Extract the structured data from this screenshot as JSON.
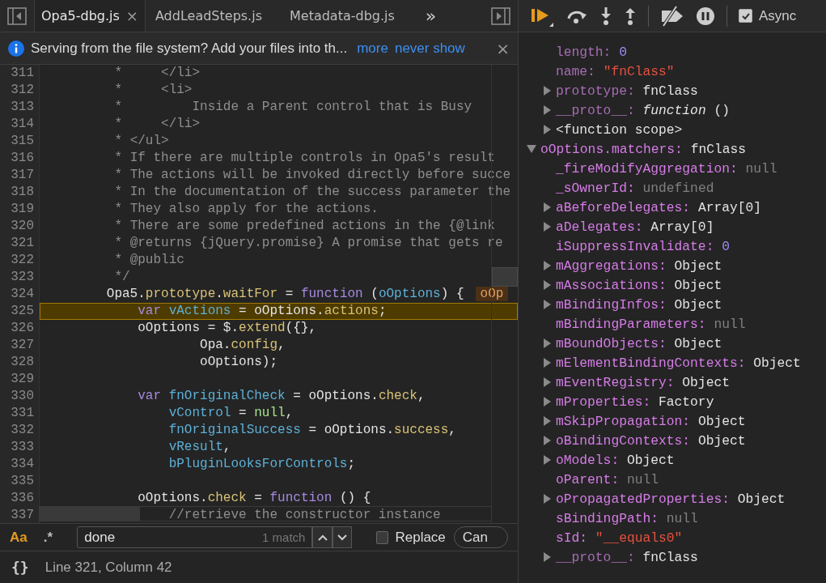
{
  "editor": {
    "tabs": [
      {
        "label": "Opa5-dbg.js",
        "selected": true,
        "close": "×"
      },
      {
        "label": "AddLeadSteps.js",
        "selected": false
      },
      {
        "label": "Metadata-dbg.js",
        "selected": false
      }
    ],
    "overflow": "»",
    "infobar": {
      "message": "Serving from the file system? Add your files into th...",
      "links": [
        "more",
        "never show"
      ],
      "close": "×"
    },
    "lines": [
      {
        "number": "311",
        "current": false,
        "tokens": [
          {
            "kind": "comment",
            "text": "         *     </li>"
          }
        ]
      },
      {
        "number": "312",
        "current": false,
        "tokens": [
          {
            "kind": "comment",
            "text": "         *     <li>"
          }
        ]
      },
      {
        "number": "313",
        "current": false,
        "tokens": [
          {
            "kind": "comment",
            "text": "         *         Inside a Parent control that is Busy"
          }
        ]
      },
      {
        "number": "314",
        "current": false,
        "tokens": [
          {
            "kind": "comment",
            "text": "         *     </li>"
          }
        ]
      },
      {
        "number": "315",
        "current": false,
        "tokens": [
          {
            "kind": "comment",
            "text": "         * </ul>"
          }
        ]
      },
      {
        "number": "316",
        "current": false,
        "tokens": [
          {
            "kind": "comment",
            "text": "         * If there are multiple controls in Opa5's result"
          }
        ]
      },
      {
        "number": "317",
        "current": false,
        "tokens": [
          {
            "kind": "comment",
            "text": "         * The actions will be invoked directly before succe"
          }
        ]
      },
      {
        "number": "318",
        "current": false,
        "tokens": [
          {
            "kind": "comment",
            "text": "         * In the documentation of the success parameter the"
          }
        ]
      },
      {
        "number": "319",
        "current": false,
        "tokens": [
          {
            "kind": "comment",
            "text": "         * They also apply for the actions."
          }
        ]
      },
      {
        "number": "320",
        "current": false,
        "tokens": [
          {
            "kind": "comment",
            "text": "         * There are some predefined actions in the {@link"
          }
        ]
      },
      {
        "number": "321",
        "current": false,
        "tokens": [
          {
            "kind": "comment",
            "text": "         * @returns {jQuery.promise} A promise that gets re"
          }
        ]
      },
      {
        "number": "322",
        "current": false,
        "tokens": [
          {
            "kind": "comment",
            "text": "         * @public"
          }
        ]
      },
      {
        "number": "323",
        "current": false,
        "tokens": [
          {
            "kind": "comment",
            "text": "         */"
          }
        ]
      },
      {
        "number": "324",
        "current": false,
        "inline_value": "oOp",
        "tokens": [
          {
            "kind": "plain",
            "text": "        Opa5."
          },
          {
            "kind": "property",
            "text": "prototype"
          },
          {
            "kind": "plain",
            "text": "."
          },
          {
            "kind": "property",
            "text": "waitFor"
          },
          {
            "kind": "plain",
            "text": " = "
          },
          {
            "kind": "keyword",
            "text": "function"
          },
          {
            "kind": "plain",
            "text": " ("
          },
          {
            "kind": "variable",
            "text": "oOptions"
          },
          {
            "kind": "plain",
            "text": ") {"
          }
        ]
      },
      {
        "number": "325",
        "current": true,
        "tokens": [
          {
            "kind": "keyword",
            "text": "            var"
          },
          {
            "kind": "variable",
            "text": " vActions"
          },
          {
            "kind": "plain",
            "text": " = oOptions."
          },
          {
            "kind": "property",
            "text": "actions"
          },
          {
            "kind": "plain",
            "text": ";"
          }
        ]
      },
      {
        "number": "326",
        "current": false,
        "tokens": [
          {
            "kind": "plain",
            "text": "            oOptions = $."
          },
          {
            "kind": "property",
            "text": "extend"
          },
          {
            "kind": "plain",
            "text": "({},"
          }
        ]
      },
      {
        "number": "327",
        "current": false,
        "tokens": [
          {
            "kind": "plain",
            "text": "                    Opa."
          },
          {
            "kind": "property",
            "text": "config"
          },
          {
            "kind": "plain",
            "text": ","
          }
        ]
      },
      {
        "number": "328",
        "current": false,
        "tokens": [
          {
            "kind": "plain",
            "text": "                    oOptions);"
          }
        ]
      },
      {
        "number": "329",
        "current": false
      },
      {
        "number": "330",
        "current": false,
        "tokens": [
          {
            "kind": "keyword",
            "text": "            var"
          },
          {
            "kind": "variable",
            "text": " fnOriginalCheck"
          },
          {
            "kind": "plain",
            "text": " = oOptions."
          },
          {
            "kind": "property",
            "text": "check"
          },
          {
            "kind": "plain",
            "text": ","
          }
        ]
      },
      {
        "number": "331",
        "current": false,
        "tokens": [
          {
            "kind": "variable",
            "text": "                vControl"
          },
          {
            "kind": "plain",
            "text": " = "
          },
          {
            "kind": "literal",
            "text": "null"
          },
          {
            "kind": "plain",
            "text": ","
          }
        ]
      },
      {
        "number": "332",
        "current": false,
        "tokens": [
          {
            "kind": "variable",
            "text": "                fnOriginalSuccess"
          },
          {
            "kind": "plain",
            "text": " = oOptions."
          },
          {
            "kind": "property",
            "text": "success"
          },
          {
            "kind": "plain",
            "text": ","
          }
        ]
      },
      {
        "number": "333",
        "current": false,
        "tokens": [
          {
            "kind": "variable",
            "text": "                vResult"
          },
          {
            "kind": "plain",
            "text": ","
          }
        ]
      },
      {
        "number": "334",
        "current": false,
        "tokens": [
          {
            "kind": "variable",
            "text": "                bPluginLooksForControls"
          },
          {
            "kind": "plain",
            "text": ";"
          }
        ]
      },
      {
        "number": "335",
        "current": false
      },
      {
        "number": "336",
        "current": false,
        "tokens": [
          {
            "kind": "plain",
            "text": "            oOptions."
          },
          {
            "kind": "property",
            "text": "check"
          },
          {
            "kind": "plain",
            "text": " = "
          },
          {
            "kind": "keyword",
            "text": "function"
          },
          {
            "kind": "plain",
            "text": " () {"
          }
        ]
      },
      {
        "number": "337",
        "current": false,
        "tokens": [
          {
            "kind": "comment",
            "text": "                //retrieve the constructor instance"
          }
        ]
      }
    ],
    "search": {
      "match_case": {
        "label": "Aa",
        "on": true
      },
      "regex": {
        "label": ".*",
        "on": false
      },
      "value": "done",
      "match_count": "1 match",
      "replace": {
        "label": "Replace",
        "checked": false
      },
      "cancel": "Can"
    },
    "status": {
      "format": "{}",
      "position": "Line 321, Column 42"
    }
  },
  "debugger": {
    "async": {
      "label": "Async",
      "checked": true
    },
    "scope_tail": [
      {
        "kind": "number",
        "expandable": false,
        "dim": true,
        "name": "length:",
        "value": "0"
      },
      {
        "kind": "string",
        "expandable": false,
        "dim": true,
        "name": "name:",
        "value": "\"fnClass\""
      },
      {
        "kind": "object",
        "expandable": true,
        "expanded": false,
        "dim": true,
        "name": "prototype:",
        "value": "fnClass"
      },
      {
        "kind": "function",
        "expandable": true,
        "expanded": false,
        "dim": true,
        "name": "__proto__:",
        "value": "*function* ()"
      },
      {
        "kind": "scope",
        "expandable": true,
        "expanded": false,
        "dim": false,
        "name": "<function scope>"
      }
    ],
    "scope": [
      {
        "kind": "object",
        "expandable": true,
        "expanded": true,
        "dim": false,
        "name": "oOptions.matchers:",
        "value": "fnClass",
        "children": [
          {
            "kind": "null",
            "expandable": false,
            "dim": false,
            "name": "_fireModifyAggregation:",
            "value": "null"
          },
          {
            "kind": "null",
            "expandable": false,
            "dim": false,
            "name": "_sOwnerId:",
            "value": "undefined"
          },
          {
            "kind": "object",
            "expandable": true,
            "expanded": false,
            "dim": false,
            "name": "aBeforeDelegates:",
            "value": "Array[0]"
          },
          {
            "kind": "object",
            "expandable": true,
            "expanded": false,
            "dim": false,
            "name": "aDelegates:",
            "value": "Array[0]"
          },
          {
            "kind": "number",
            "expandable": false,
            "dim": false,
            "name": "iSuppressInvalidate:",
            "value": "0"
          },
          {
            "kind": "object",
            "expandable": true,
            "expanded": false,
            "dim": false,
            "name": "mAggregations:",
            "value": "Object"
          },
          {
            "kind": "object",
            "expandable": true,
            "expanded": false,
            "dim": false,
            "name": "mAssociations:",
            "value": "Object"
          },
          {
            "kind": "object",
            "expandable": true,
            "expanded": false,
            "dim": false,
            "name": "mBindingInfos:",
            "value": "Object"
          },
          {
            "kind": "null",
            "expandable": false,
            "dim": false,
            "name": "mBindingParameters:",
            "value": "null"
          },
          {
            "kind": "object",
            "expandable": true,
            "expanded": false,
            "dim": false,
            "name": "mBoundObjects:",
            "value": "Object"
          },
          {
            "kind": "object",
            "expandable": true,
            "expanded": false,
            "dim": false,
            "name": "mElementBindingContexts:",
            "value": "Object"
          },
          {
            "kind": "object",
            "expandable": true,
            "expanded": false,
            "dim": false,
            "name": "mEventRegistry:",
            "value": "Object"
          },
          {
            "kind": "object",
            "expandable": true,
            "expanded": false,
            "dim": false,
            "name": "mProperties:",
            "value": "Factory"
          },
          {
            "kind": "object",
            "expandable": true,
            "expanded": false,
            "dim": false,
            "name": "mSkipPropagation:",
            "value": "Object"
          },
          {
            "kind": "object",
            "expandable": true,
            "expanded": false,
            "dim": false,
            "name": "oBindingContexts:",
            "value": "Object"
          },
          {
            "kind": "object",
            "expandable": true,
            "expanded": false,
            "dim": false,
            "name": "oModels:",
            "value": "Object"
          },
          {
            "kind": "null",
            "expandable": false,
            "dim": false,
            "name": "oParent:",
            "value": "null"
          },
          {
            "kind": "object",
            "expandable": true,
            "expanded": false,
            "dim": false,
            "name": "oPropagatedProperties:",
            "value": "Object"
          },
          {
            "kind": "null",
            "expandable": false,
            "dim": false,
            "name": "sBindingPath:",
            "value": "null"
          },
          {
            "kind": "string",
            "expandable": false,
            "dim": false,
            "name": "sId:",
            "value": "\"__equals0\""
          },
          {
            "kind": "object",
            "expandable": true,
            "expanded": false,
            "dim": true,
            "name": "__proto__:",
            "value": "fnClass"
          }
        ]
      }
    ]
  }
}
